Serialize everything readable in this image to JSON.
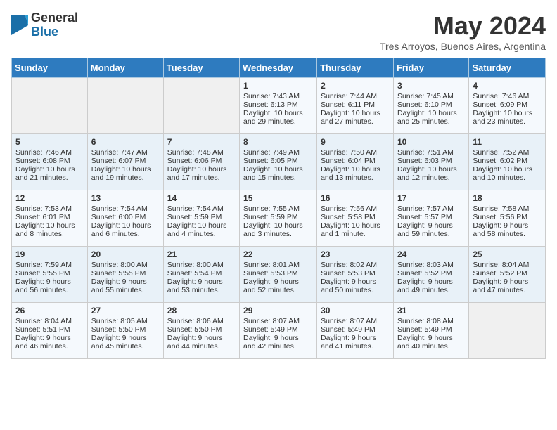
{
  "header": {
    "logo_general": "General",
    "logo_blue": "Blue",
    "title": "May 2024",
    "location": "Tres Arroyos, Buenos Aires, Argentina"
  },
  "weekdays": [
    "Sunday",
    "Monday",
    "Tuesday",
    "Wednesday",
    "Thursday",
    "Friday",
    "Saturday"
  ],
  "weeks": [
    [
      {
        "day": null,
        "lines": []
      },
      {
        "day": null,
        "lines": []
      },
      {
        "day": null,
        "lines": []
      },
      {
        "day": "1",
        "lines": [
          "Sunrise: 7:43 AM",
          "Sunset: 6:13 PM",
          "Daylight: 10 hours",
          "and 29 minutes."
        ]
      },
      {
        "day": "2",
        "lines": [
          "Sunrise: 7:44 AM",
          "Sunset: 6:11 PM",
          "Daylight: 10 hours",
          "and 27 minutes."
        ]
      },
      {
        "day": "3",
        "lines": [
          "Sunrise: 7:45 AM",
          "Sunset: 6:10 PM",
          "Daylight: 10 hours",
          "and 25 minutes."
        ]
      },
      {
        "day": "4",
        "lines": [
          "Sunrise: 7:46 AM",
          "Sunset: 6:09 PM",
          "Daylight: 10 hours",
          "and 23 minutes."
        ]
      }
    ],
    [
      {
        "day": "5",
        "lines": [
          "Sunrise: 7:46 AM",
          "Sunset: 6:08 PM",
          "Daylight: 10 hours",
          "and 21 minutes."
        ]
      },
      {
        "day": "6",
        "lines": [
          "Sunrise: 7:47 AM",
          "Sunset: 6:07 PM",
          "Daylight: 10 hours",
          "and 19 minutes."
        ]
      },
      {
        "day": "7",
        "lines": [
          "Sunrise: 7:48 AM",
          "Sunset: 6:06 PM",
          "Daylight: 10 hours",
          "and 17 minutes."
        ]
      },
      {
        "day": "8",
        "lines": [
          "Sunrise: 7:49 AM",
          "Sunset: 6:05 PM",
          "Daylight: 10 hours",
          "and 15 minutes."
        ]
      },
      {
        "day": "9",
        "lines": [
          "Sunrise: 7:50 AM",
          "Sunset: 6:04 PM",
          "Daylight: 10 hours",
          "and 13 minutes."
        ]
      },
      {
        "day": "10",
        "lines": [
          "Sunrise: 7:51 AM",
          "Sunset: 6:03 PM",
          "Daylight: 10 hours",
          "and 12 minutes."
        ]
      },
      {
        "day": "11",
        "lines": [
          "Sunrise: 7:52 AM",
          "Sunset: 6:02 PM",
          "Daylight: 10 hours",
          "and 10 minutes."
        ]
      }
    ],
    [
      {
        "day": "12",
        "lines": [
          "Sunrise: 7:53 AM",
          "Sunset: 6:01 PM",
          "Daylight: 10 hours",
          "and 8 minutes."
        ]
      },
      {
        "day": "13",
        "lines": [
          "Sunrise: 7:54 AM",
          "Sunset: 6:00 PM",
          "Daylight: 10 hours",
          "and 6 minutes."
        ]
      },
      {
        "day": "14",
        "lines": [
          "Sunrise: 7:54 AM",
          "Sunset: 5:59 PM",
          "Daylight: 10 hours",
          "and 4 minutes."
        ]
      },
      {
        "day": "15",
        "lines": [
          "Sunrise: 7:55 AM",
          "Sunset: 5:59 PM",
          "Daylight: 10 hours",
          "and 3 minutes."
        ]
      },
      {
        "day": "16",
        "lines": [
          "Sunrise: 7:56 AM",
          "Sunset: 5:58 PM",
          "Daylight: 10 hours",
          "and 1 minute."
        ]
      },
      {
        "day": "17",
        "lines": [
          "Sunrise: 7:57 AM",
          "Sunset: 5:57 PM",
          "Daylight: 9 hours",
          "and 59 minutes."
        ]
      },
      {
        "day": "18",
        "lines": [
          "Sunrise: 7:58 AM",
          "Sunset: 5:56 PM",
          "Daylight: 9 hours",
          "and 58 minutes."
        ]
      }
    ],
    [
      {
        "day": "19",
        "lines": [
          "Sunrise: 7:59 AM",
          "Sunset: 5:55 PM",
          "Daylight: 9 hours",
          "and 56 minutes."
        ]
      },
      {
        "day": "20",
        "lines": [
          "Sunrise: 8:00 AM",
          "Sunset: 5:55 PM",
          "Daylight: 9 hours",
          "and 55 minutes."
        ]
      },
      {
        "day": "21",
        "lines": [
          "Sunrise: 8:00 AM",
          "Sunset: 5:54 PM",
          "Daylight: 9 hours",
          "and 53 minutes."
        ]
      },
      {
        "day": "22",
        "lines": [
          "Sunrise: 8:01 AM",
          "Sunset: 5:53 PM",
          "Daylight: 9 hours",
          "and 52 minutes."
        ]
      },
      {
        "day": "23",
        "lines": [
          "Sunrise: 8:02 AM",
          "Sunset: 5:53 PM",
          "Daylight: 9 hours",
          "and 50 minutes."
        ]
      },
      {
        "day": "24",
        "lines": [
          "Sunrise: 8:03 AM",
          "Sunset: 5:52 PM",
          "Daylight: 9 hours",
          "and 49 minutes."
        ]
      },
      {
        "day": "25",
        "lines": [
          "Sunrise: 8:04 AM",
          "Sunset: 5:52 PM",
          "Daylight: 9 hours",
          "and 47 minutes."
        ]
      }
    ],
    [
      {
        "day": "26",
        "lines": [
          "Sunrise: 8:04 AM",
          "Sunset: 5:51 PM",
          "Daylight: 9 hours",
          "and 46 minutes."
        ]
      },
      {
        "day": "27",
        "lines": [
          "Sunrise: 8:05 AM",
          "Sunset: 5:50 PM",
          "Daylight: 9 hours",
          "and 45 minutes."
        ]
      },
      {
        "day": "28",
        "lines": [
          "Sunrise: 8:06 AM",
          "Sunset: 5:50 PM",
          "Daylight: 9 hours",
          "and 44 minutes."
        ]
      },
      {
        "day": "29",
        "lines": [
          "Sunrise: 8:07 AM",
          "Sunset: 5:49 PM",
          "Daylight: 9 hours",
          "and 42 minutes."
        ]
      },
      {
        "day": "30",
        "lines": [
          "Sunrise: 8:07 AM",
          "Sunset: 5:49 PM",
          "Daylight: 9 hours",
          "and 41 minutes."
        ]
      },
      {
        "day": "31",
        "lines": [
          "Sunrise: 8:08 AM",
          "Sunset: 5:49 PM",
          "Daylight: 9 hours",
          "and 40 minutes."
        ]
      },
      {
        "day": null,
        "lines": []
      }
    ]
  ]
}
